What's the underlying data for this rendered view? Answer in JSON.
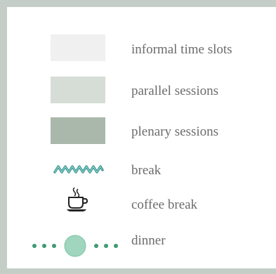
{
  "legend": {
    "items": [
      {
        "label": "informal time slots",
        "icon": "swatch",
        "color": "#f0f0f0"
      },
      {
        "label": "parallel sessions",
        "icon": "swatch",
        "color": "#d6dcd6"
      },
      {
        "label": "plenary sessions",
        "icon": "swatch",
        "color": "#a9b8ab"
      },
      {
        "label": "break",
        "icon": "zigzag-wave-icon",
        "color": "#2f8c88"
      },
      {
        "label": "coffee break",
        "icon": "coffee-cup-icon",
        "color": "#222222"
      },
      {
        "label": "dinner",
        "icon": "dotted-circle-icon",
        "color": "#3f9a72"
      }
    ]
  }
}
